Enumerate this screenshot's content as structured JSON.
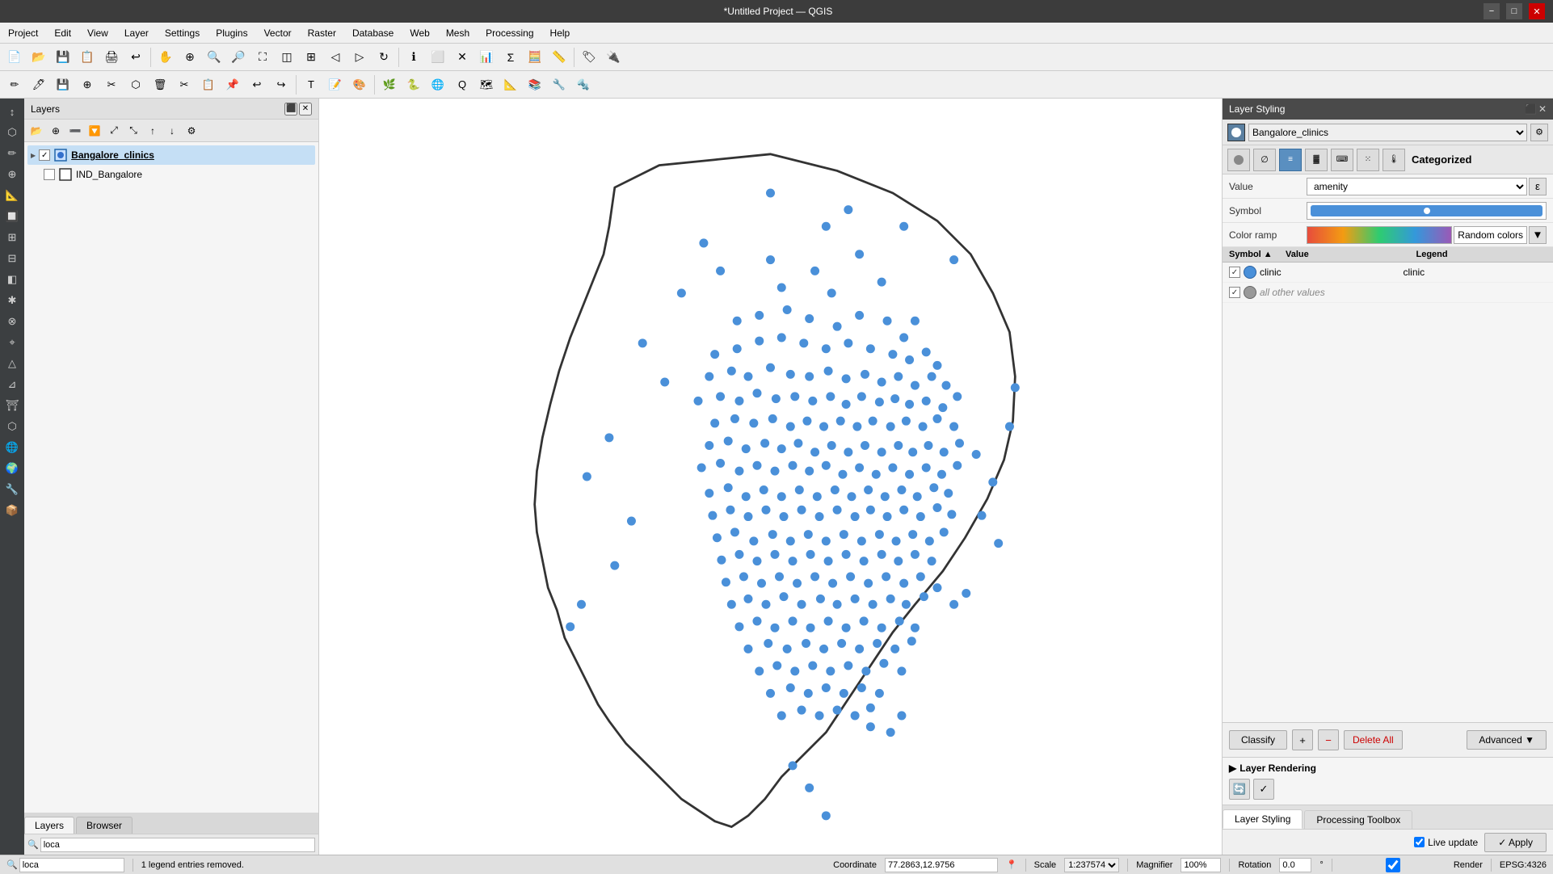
{
  "titlebar": {
    "title": "*Untitled Project — QGIS",
    "minimize": "−",
    "maximize": "□",
    "close": "✕"
  },
  "menubar": {
    "items": [
      "Project",
      "Edit",
      "View",
      "Layer",
      "Settings",
      "Plugins",
      "Vector",
      "Raster",
      "Database",
      "Web",
      "Mesh",
      "Processing",
      "Help"
    ]
  },
  "layers_panel": {
    "title": "Layers",
    "layers": [
      {
        "name": "Bangalore_clinics",
        "bold": true,
        "checked": true,
        "indent": 0
      },
      {
        "name": "IND_Bangalore",
        "bold": false,
        "checked": false,
        "indent": 1
      }
    ]
  },
  "layers_tabs": {
    "items": [
      "Layers",
      "Browser"
    ]
  },
  "styling_panel": {
    "title": "Layer Styling",
    "selected_layer": "Bangalore_clinics",
    "renderer": "Categorized",
    "value_field": "amenity",
    "symbol_label": "Symbol",
    "color_ramp_label": "Color ramp",
    "color_ramp_value": "Random colors",
    "table": {
      "headers": [
        "Symbol",
        "Value",
        "Legend"
      ],
      "rows": [
        {
          "checked": true,
          "color": "#4a90d9",
          "value": "clinic",
          "legend": "clinic"
        },
        {
          "checked": true,
          "color": "#999999",
          "value": "all other values",
          "legend": "",
          "italic": true
        }
      ]
    },
    "buttons": {
      "classify": "Classify",
      "delete_all": "Delete All",
      "advanced": "Advanced ▼"
    },
    "layer_rendering": "Layer Rendering",
    "tabs": [
      "Layer Styling",
      "Processing Toolbox"
    ],
    "live_update_label": "Live update",
    "apply_label": "Apply"
  },
  "statusbar": {
    "search_placeholder": "loca",
    "message": "1 legend entries removed.",
    "coordinate_label": "Coordinate",
    "coordinate_value": "77.2863,12.9756",
    "scale_label": "Scale",
    "scale_value": "1:237574",
    "magnifier_label": "Magnifier",
    "magnifier_value": "100%",
    "rotation_label": "Rotation",
    "rotation_value": "0.0 °",
    "render_label": "Render",
    "epsg_label": "EPSG:4326"
  }
}
